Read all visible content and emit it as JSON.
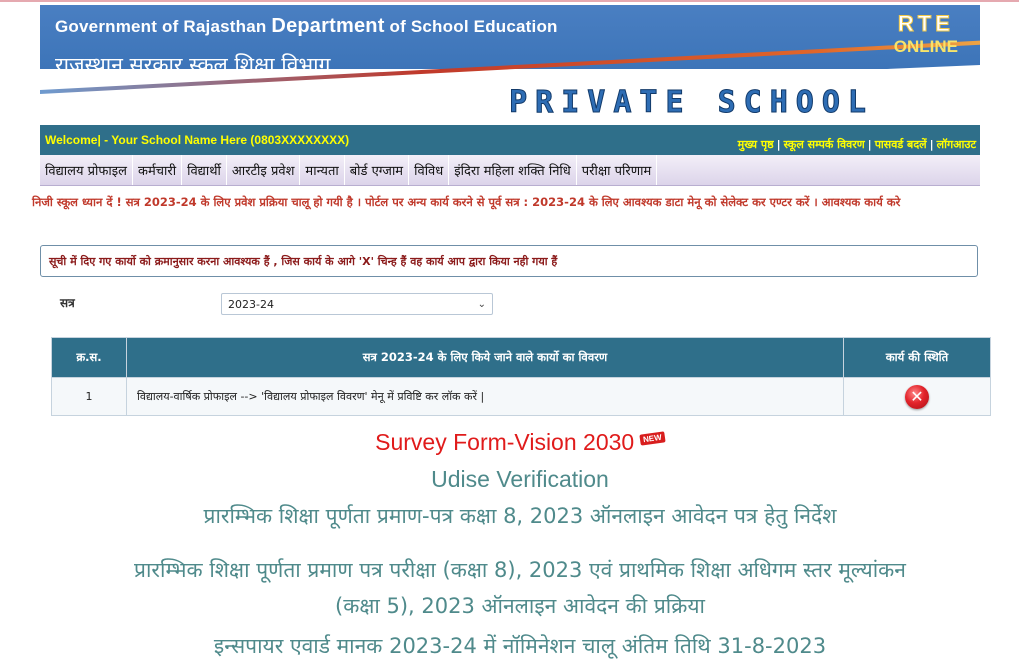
{
  "header": {
    "title_en_part1": "Government of Rajasthan",
    "title_en_part2": "Department",
    "title_en_part3": "of School Education",
    "title_hi": "राजस्थान सरकार स्कूल शिक्षा विभाग",
    "rte_line1": "RTE",
    "rte_line2": "ONLINE",
    "banner_text": "PRIVATE SCHOOL"
  },
  "welcome": {
    "text": "Welcome| - Your School Name Here (0803XXXXXXXX)"
  },
  "toplinks": [
    "मुख्य पृष्ठ",
    "स्कूल सम्पर्क विवरण",
    "पासवर्ड बदलें",
    "लॉगआउट"
  ],
  "menu": [
    "विद्यालय प्रोफाइल",
    "कर्मचारी",
    "विद्यार्थी",
    "आरटीइ प्रवेश",
    "मान्यता",
    "बोर्ड एग्जाम",
    "विविध",
    "इंदिरा महिला शक्ति निधि",
    "परीक्षा परिणाम"
  ],
  "marquee": "निजी स्कूल ध्यान दें ! सत्र 2023-24 के लिए प्रवेश प्रक्रिया चालू हो गयी है । पोर्टल पर अन्य कार्य करने से पूर्व सत्र : 2023-24 के लिए आवश्यक डाटा मेनू को सेलेक्ट कर एण्टर करें । आवश्यक कार्य करे",
  "notice": "सूची में दिए गए कार्यो को क्रमानुसार करना आवश्यक हैं , जिस कार्य के आगे 'X' चिन्ह हैं वह कार्य आप द्वारा किया नही गया हैं",
  "session": {
    "label": "सत्र",
    "selected": "2023-24"
  },
  "table": {
    "headers": [
      "क्र.स.",
      "सत्र 2023-24 के लिए किये जाने वाले कार्यो का विवरण",
      "कार्य की स्थिति"
    ],
    "rows": [
      {
        "sno": "1",
        "desc": "विद्यालय-वार्षिक प्रोफाइल --> 'विद्यालय प्रोफाइल विवरण' मेनू में प्रविष्टि कर लॉक करें |",
        "status_icon": "close-icon"
      }
    ]
  },
  "links": {
    "survey": "Survey Form-Vision 2030",
    "new_badge": "NEW",
    "udise": "Udise Verification",
    "l3": "प्रारम्भिक शिक्षा पूर्णता प्रमाण-पत्र कक्षा 8, 2023 ऑनलाइन आवेदन पत्र हेतु निर्देश",
    "l4": "प्रारम्भिक शिक्षा पूर्णता प्रमाण पत्र परीक्षा (कक्षा 8), 2023 एवं प्राथमिक शिक्षा अधिगम स्तर मूल्यांकन",
    "l5": "(कक्षा 5), 2023 ऑनलाइन आवेदन की प्रक्रिया",
    "l6": "इन्सपायर एवार्ड मानक 2023-24 में नॉमिनेशन चालू अंतिम तिथि 31-8-2023"
  },
  "colors": {
    "header_blue": "#3c74b8",
    "bar_teal": "#2f6f8a",
    "link_teal": "#4f8a8b",
    "alert_red": "#c0392b",
    "survey_red": "#e01b1b"
  }
}
